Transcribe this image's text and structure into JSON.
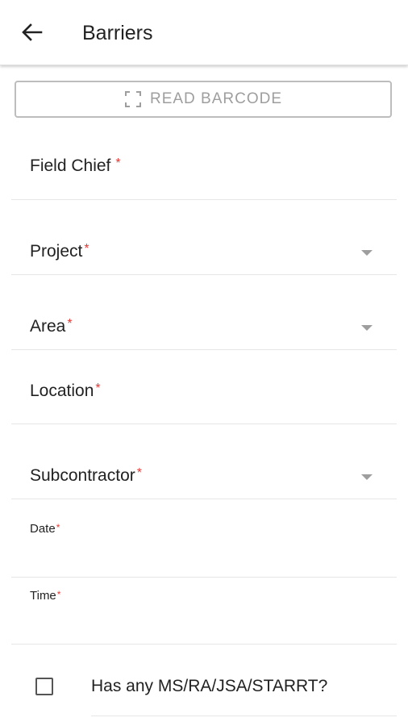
{
  "app_bar": {
    "title": "Barriers",
    "back_icon": "arrow-left-icon"
  },
  "barcode_button": {
    "label": "READ BARCODE",
    "icon": "scan-frame-icon"
  },
  "fields": {
    "field_chief": {
      "label": "Field Chief",
      "required_mark": "*"
    },
    "project": {
      "label": "Project",
      "required_mark": "*"
    },
    "area": {
      "label": "Area",
      "required_mark": "*"
    },
    "location": {
      "label": "Location",
      "required_mark": "*"
    },
    "subcontractor": {
      "label": "Subcontractor",
      "required_mark": "*"
    },
    "date": {
      "label": "Date",
      "required_mark": "*"
    },
    "time": {
      "label": "Time",
      "required_mark": "*"
    }
  },
  "checkbox": {
    "label": "Has any MS/RA/JSA/STARRT?",
    "checked": false
  },
  "colors": {
    "required": "#e53935",
    "divider": "#e6e6e6",
    "muted": "#9e9e9e"
  }
}
